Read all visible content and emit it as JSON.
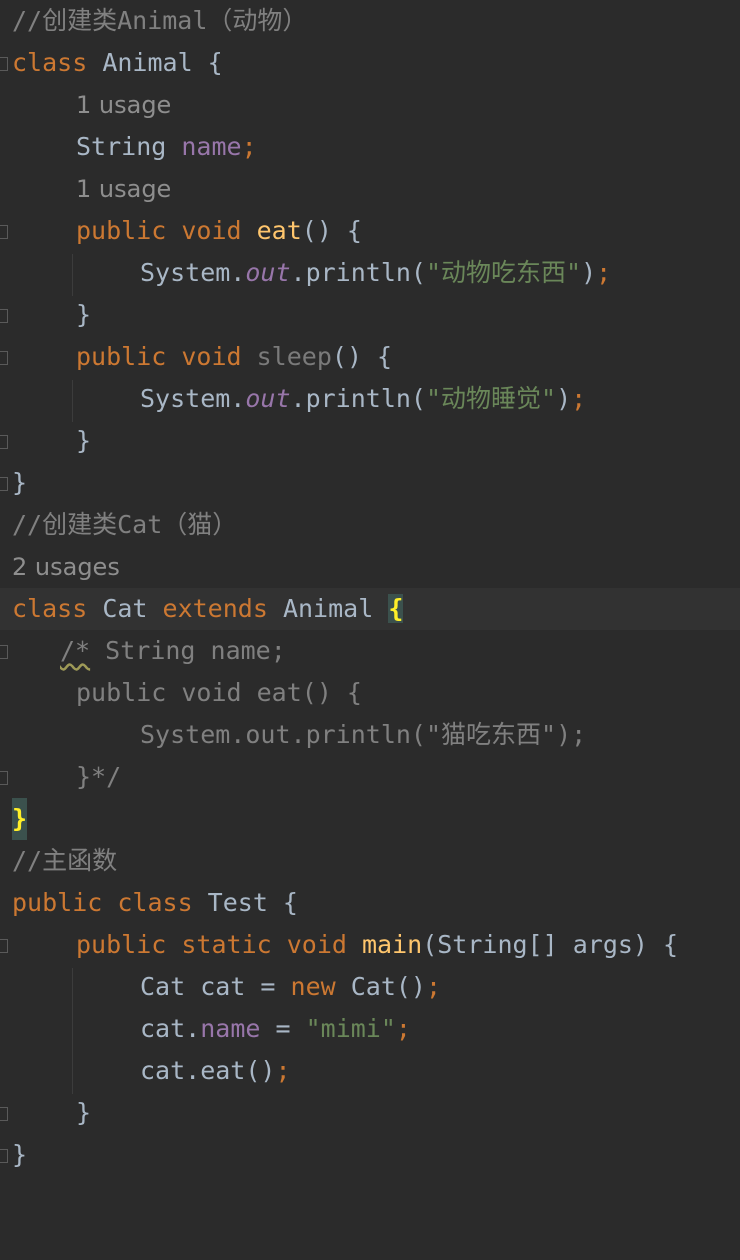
{
  "code": {
    "l1_comment": "//创建类Animal（动物）",
    "l2_kw_class": "class",
    "l2_name": " Animal {",
    "l3_hint": "1 usage",
    "l4_type": "String ",
    "l4_field": "name",
    "l4_semi": ";",
    "l5_hint": "1 usage",
    "l6_kw": "public void ",
    "l6_method": "eat",
    "l6_rest": "() {",
    "l7_sys": "System.",
    "l7_out": "out",
    "l7_println": ".println(",
    "l7_str": "\"动物吃东西\"",
    "l7_close": ")",
    "l7_semi": ";",
    "l8_brace": "}",
    "l9_kw": "public void ",
    "l9_method": "sleep",
    "l9_rest": "() {",
    "l10_sys": "System.",
    "l10_out": "out",
    "l10_println": ".println(",
    "l10_str": "\"动物睡觉\"",
    "l10_close": ")",
    "l10_semi": ";",
    "l11_brace": "}",
    "l12_brace": "}",
    "l13_comment": "//创建类Cat（猫）",
    "l14_hint": "2 usages",
    "l15_kw_class": "class",
    "l15_name": " Cat ",
    "l15_kw_extends": "extends",
    "l15_parent": " Animal ",
    "l15_brace": "{",
    "l16_cmt_start": "/*",
    "l16_cmt_rest": " String name;",
    "l17_cmt": "public void eat() {",
    "l18_cmt": "System.out.println(\"猫吃东西\");",
    "l19_cmt": "}*/",
    "l20_brace": "}",
    "l21_comment": "//主函数",
    "l22_kw": "public class",
    "l22_name": " Test {",
    "l23_kw": "public static void ",
    "l23_method": "main",
    "l23_rest": "(String[] args) {",
    "l24_decl": "Cat cat = ",
    "l24_kw_new": "new",
    "l24_ctor": " Cat()",
    "l24_semi": ";",
    "l25_obj": "cat.",
    "l25_field": "name",
    "l25_eq": " = ",
    "l25_str": "\"mimi\"",
    "l25_semi": ";",
    "l26_call": "cat.eat()",
    "l26_semi": ";",
    "l27_brace": "}",
    "l28_brace": "}"
  },
  "theme": {
    "background": "#2b2b2b",
    "keyword": "#cc7832",
    "field": "#9876aa",
    "string": "#6a8759",
    "method": "#ffc66d",
    "comment": "#808080",
    "text": "#a9b7c6",
    "brace_match": "#ffef28"
  }
}
